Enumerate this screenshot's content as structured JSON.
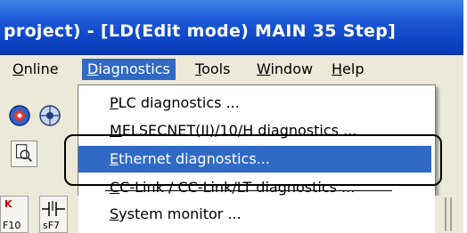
{
  "window": {
    "title": "project) - [LD(Edit mode)    MAIN    35 Step]"
  },
  "menubar": {
    "items": [
      {
        "pre": "",
        "acc": "O",
        "post": "nline"
      },
      {
        "pre": "",
        "acc": "D",
        "post": "iagnostics"
      },
      {
        "pre": "",
        "acc": "T",
        "post": "ools"
      },
      {
        "pre": "",
        "acc": "W",
        "post": "indow"
      },
      {
        "pre": "",
        "acc": "H",
        "post": "elp"
      }
    ]
  },
  "diagnostics_menu": {
    "items": [
      {
        "pre": "",
        "acc": "P",
        "post": "LC diagnostics ..."
      },
      {
        "pre": "",
        "acc": "M",
        "post": "ELSECNET(II)/10/H diagnostics ..."
      },
      {
        "pre": "",
        "acc": "E",
        "post": "thernet diagnostics..."
      },
      {
        "pre": "",
        "acc": "C",
        "post": "C-Link / CC-Link/LT diagnostics ..."
      },
      {
        "pre": "",
        "acc": "S",
        "post": "ystem monitor ..."
      }
    ],
    "selected_index": 2
  },
  "ladder_toolbar": {
    "left_label_top": "K",
    "left_label_bottom": "F10",
    "right_label_bottom": "sF7"
  },
  "colors": {
    "titlebar": "#1c5ad6",
    "highlight": "#316ac5",
    "menu_bg": "#ffffff",
    "chrome": "#ece9d8"
  }
}
